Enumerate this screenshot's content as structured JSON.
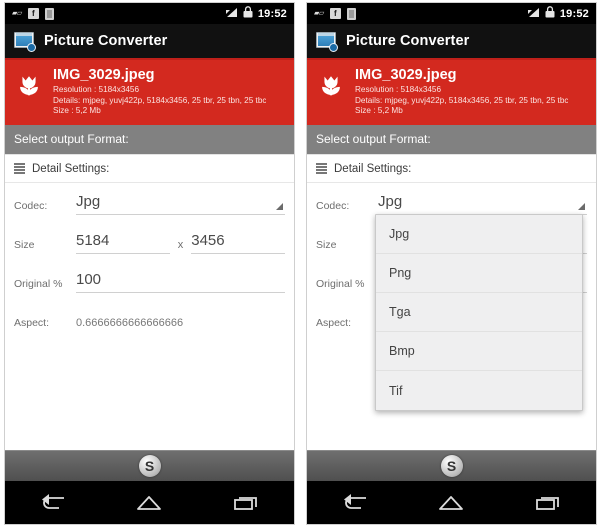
{
  "screen": {
    "status_bar": {
      "icons": [
        "sd-card-icon",
        "facebook-icon",
        "document-icon"
      ],
      "facebook_glyph": "f",
      "signal_icon": "signal-bars-icon",
      "lock_icon": "lock-icon",
      "clock": "19:52"
    },
    "action_bar": {
      "app_icon": "picture-converter-app-icon",
      "title": "Picture Converter",
      "accent_color": "#c0201a"
    },
    "file_banner": {
      "thumbnail_icon": "tulip-flower-icon",
      "file_name": "IMG_3029.jpeg",
      "resolution_line": "Resolution : 5184x3456",
      "details_line": "Details: mjpeg, yuvj422p, 5184x3456, 25 tbr, 25 tbn, 25 tbc",
      "size_line": "Size : 5,2 Mb",
      "background_color": "#d3291f"
    },
    "select_output_bar": {
      "label": "Select output Format:",
      "background_color": "#818181"
    },
    "detail_settings": {
      "icon": "list-lines-icon",
      "label": "Detail Settings:"
    },
    "form": {
      "codec": {
        "label": "Codec:",
        "value": "Jpg",
        "spinner_icon": "spinner-triangle-icon"
      },
      "size": {
        "label": "Size",
        "width_value": "5184",
        "separator": "x",
        "height_value": "3456"
      },
      "original_percent": {
        "label": "Original %",
        "value": "100"
      },
      "aspect": {
        "label": "Aspect:",
        "value": "0.6666666666666666"
      }
    },
    "codec_dropdown": {
      "open_on_right_panel": true,
      "options": [
        "Jpg",
        "Png",
        "Tga",
        "Bmp",
        "Tif"
      ]
    },
    "anchor_bar": {
      "button_icon": "circular-swirl-icon",
      "glyph": "S"
    },
    "navigation_bar": {
      "buttons": [
        {
          "name": "back-button",
          "icon": "back-arrow-icon"
        },
        {
          "name": "home-button",
          "icon": "home-icon"
        },
        {
          "name": "recents-button",
          "icon": "recents-icon"
        }
      ]
    }
  }
}
